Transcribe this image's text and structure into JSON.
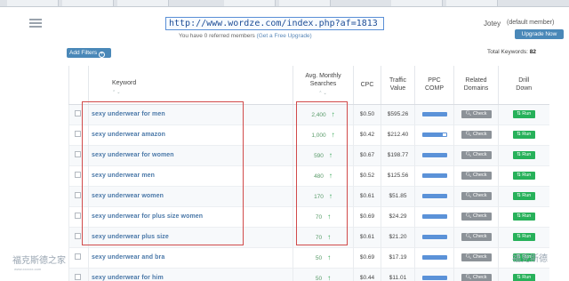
{
  "browser": {
    "url": "http://www.wordze.com/index.php?af=1813"
  },
  "header": {
    "referred_prefix": "You have 0 referred members",
    "referred_link": "(Get a Free Upgrade)",
    "username": "Jotey",
    "membership": "(default member)",
    "upgrade_label": "Upgrade Now"
  },
  "toolbar": {
    "add_filters_label": "Add Filters",
    "total_keywords_label": "Total Keywords:",
    "total_keywords_value": "82"
  },
  "table": {
    "columns": {
      "keyword": "Keyword",
      "searches_line1": "Avg. Monthly",
      "searches_line2": "Searches",
      "cpc": "CPC",
      "traffic_line1": "Traffic",
      "traffic_line2": "Value",
      "comp_line1": "PPC",
      "comp_line2": "COMP",
      "related_line1": "Related",
      "related_line2": "Domains",
      "drill_line1": "Drill",
      "drill_line2": "Down"
    },
    "check_label": "Check",
    "run_label": "Run",
    "rows": [
      {
        "keyword": "sexy underwear for men",
        "searches": "2,400",
        "cpc": "$0.50",
        "traffic": "$595.26",
        "comp": 1.0
      },
      {
        "keyword": "sexy underwear amazon",
        "searches": "1,000",
        "cpc": "$0.42",
        "traffic": "$212.40",
        "comp": 0.85
      },
      {
        "keyword": "sexy underwear for women",
        "searches": "590",
        "cpc": "$0.67",
        "traffic": "$198.77",
        "comp": 1.0
      },
      {
        "keyword": "sexy underwear men",
        "searches": "480",
        "cpc": "$0.52",
        "traffic": "$125.56",
        "comp": 1.0
      },
      {
        "keyword": "sexy underwear women",
        "searches": "170",
        "cpc": "$0.61",
        "traffic": "$51.85",
        "comp": 1.0
      },
      {
        "keyword": "sexy underwear for plus size women",
        "searches": "70",
        "cpc": "$0.69",
        "traffic": "$24.29",
        "comp": 1.0
      },
      {
        "keyword": "sexy underwear plus size",
        "searches": "70",
        "cpc": "$0.61",
        "traffic": "$21.20",
        "comp": 1.0
      },
      {
        "keyword": "sexy underwear and bra",
        "searches": "50",
        "cpc": "$0.69",
        "traffic": "$17.19",
        "comp": 1.0
      },
      {
        "keyword": "sexy underwear for him",
        "searches": "50",
        "cpc": "$0.44",
        "traffic": "$11.01",
        "comp": 1.0
      }
    ]
  },
  "watermarks": {
    "left": "福克斯德之家",
    "left_url": "www.xxxxxx.com",
    "right": "福克斯德"
  },
  "colors": {
    "accent": "#4a88b8",
    "keyword_link": "#4a78a8",
    "trend_up": "#2ea44f",
    "comp_bar": "#5b92d8",
    "run_button": "#27b15a",
    "check_button": "#8c9298",
    "highlight_box": "#d14a4a"
  }
}
